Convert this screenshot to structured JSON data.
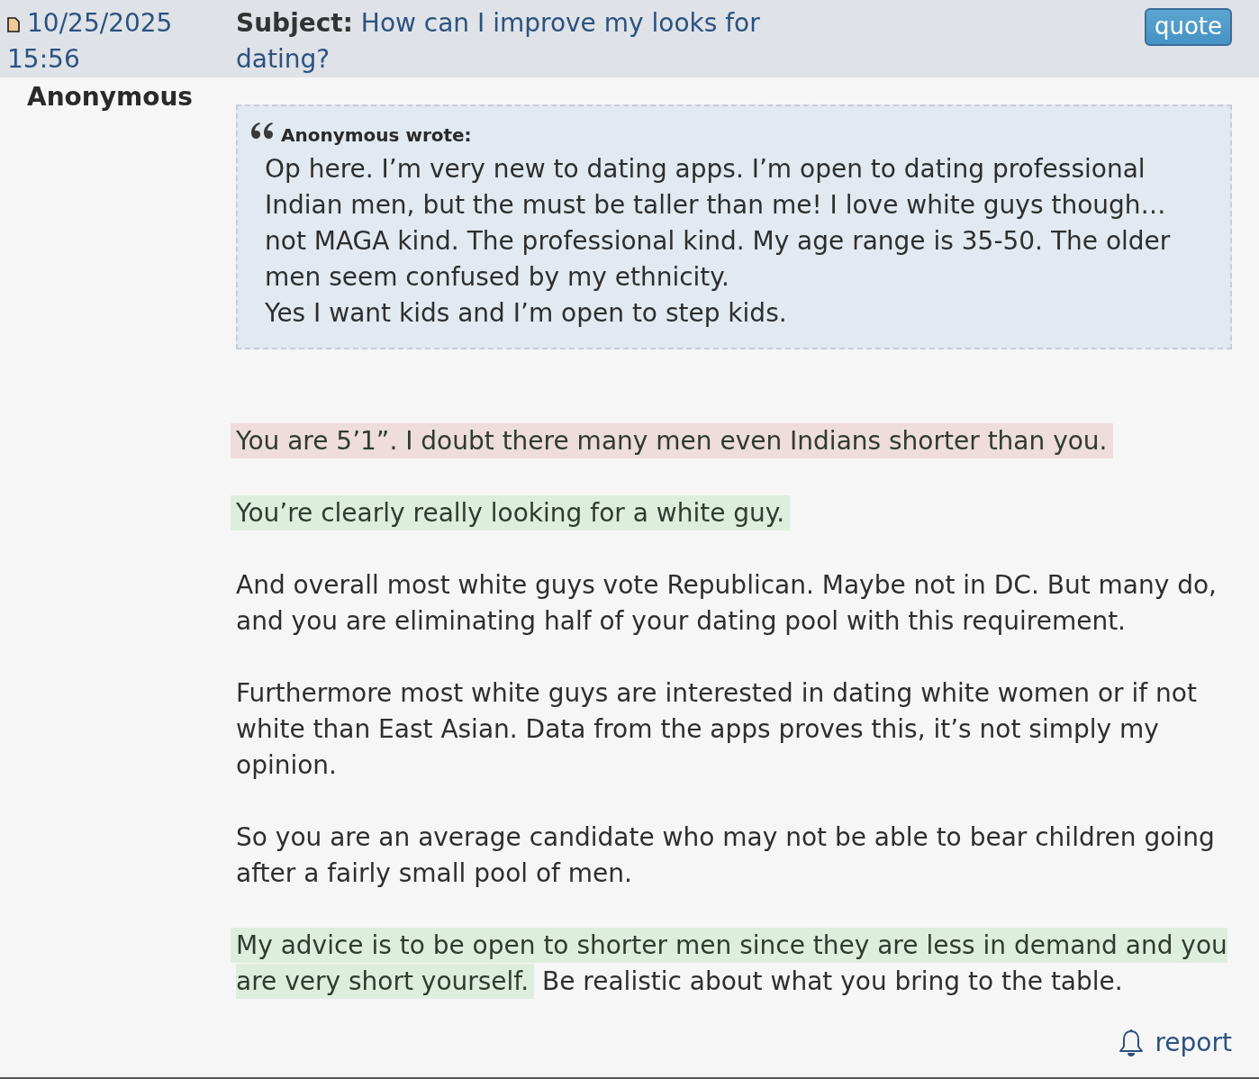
{
  "post": {
    "date": "10/25/2025 15:56",
    "subject_label": "Subject:",
    "subject": "How can I improve my looks for dating?",
    "quote_button": "quote",
    "author": "Anonymous"
  },
  "quote": {
    "author_line": "Anonymous wrote:",
    "paragraphs": [
      "Op here. I’m very new to dating apps. I’m open to dating professional Indian men, but the must be taller than me! I love white guys though… not MAGA kind. The professional kind. My age range is 35-50. The older men seem confused by my ethnicity.",
      "Yes I want kids and I’m open to step kids."
    ]
  },
  "paragraphs": [
    {
      "segments": [
        {
          "text": "You are 5’1”. I doubt there many men even Indians shorter than you.",
          "color": "#efdcdd"
        }
      ]
    },
    {
      "segments": [
        {
          "text": "You’re clearly really looking for a white guy.",
          "color": "#deeede"
        }
      ]
    },
    {
      "segments": [
        {
          "text": "And overall most white guys vote Republican. Maybe not in DC. But many do, and you are eliminating half of your dating pool with this requirement."
        }
      ]
    },
    {
      "segments": [
        {
          "text": "Furthermore most white guys are interested in dating white women or if not white than East Asian. Data from the apps proves this, it’s not simply my opinion."
        }
      ]
    },
    {
      "segments": [
        {
          "text": "So you are an average candidate who may not be able to bear children going after a fairly small pool of men."
        }
      ]
    },
    {
      "segments": [
        {
          "text": "My advice is to be open to shorter men since they are less in demand and you are very short yourself.",
          "color": "#deeede"
        },
        {
          "text": " Be realistic about what you bring to the table."
        }
      ]
    }
  ],
  "report": {
    "label": "report"
  }
}
